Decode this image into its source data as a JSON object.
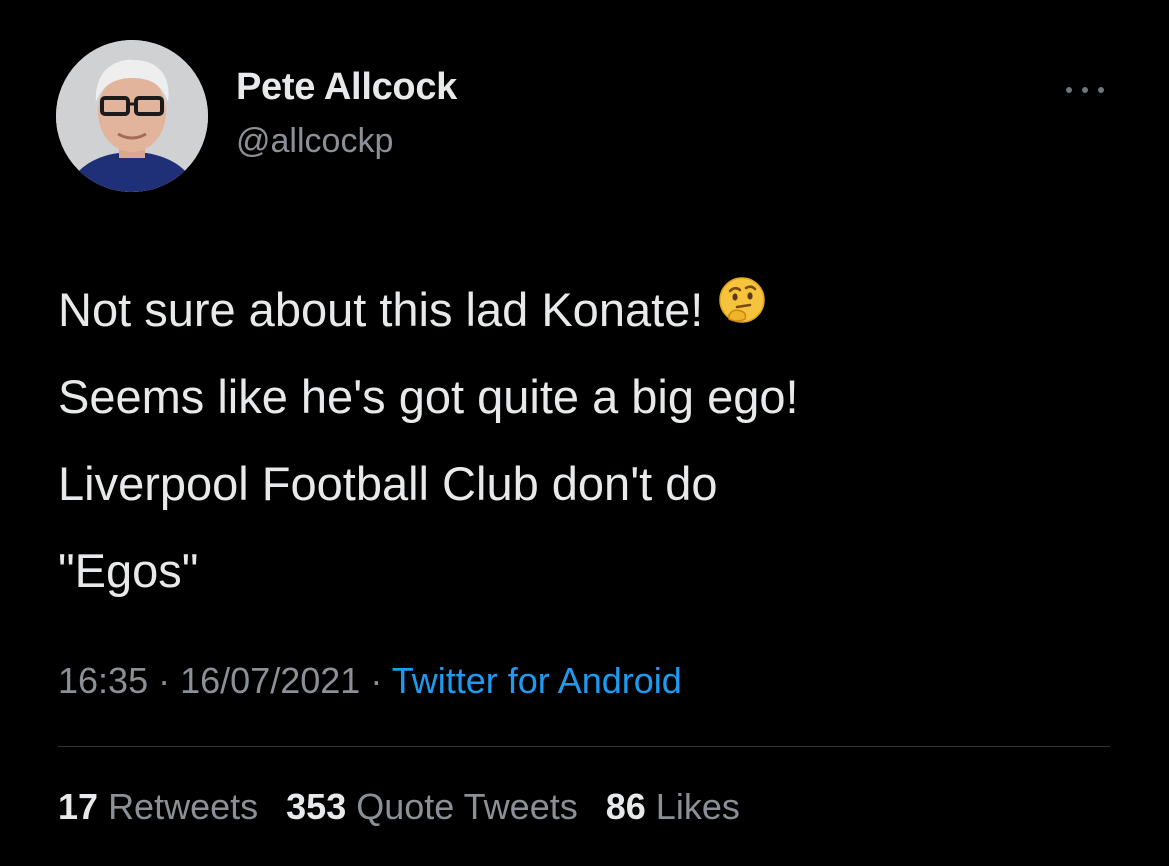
{
  "author": {
    "display_name": "Pete Allcock",
    "handle": "@allcockp"
  },
  "more_icon": "more-horizontal-icon",
  "tweet": {
    "lines": [
      "Not sure about this lad Konate!",
      "Seems like he's got quite a big ego!",
      "Liverpool Football Club don't do",
      "\"Egos\""
    ],
    "emoji": "thinking-face-emoji"
  },
  "meta": {
    "time": "16:35",
    "separator": "·",
    "date": "16/07/2021",
    "source": "Twitter for Android"
  },
  "stats": {
    "retweets_count": "17",
    "retweets_label": "Retweets",
    "quotes_count": "353",
    "quotes_label": "Quote Tweets",
    "likes_count": "86",
    "likes_label": "Likes"
  },
  "colors": {
    "background": "#000000",
    "primary_text": "#e7e9ea",
    "secondary_text": "#8b9096",
    "link": "#1d9bf0",
    "divider": "#2f3336"
  }
}
